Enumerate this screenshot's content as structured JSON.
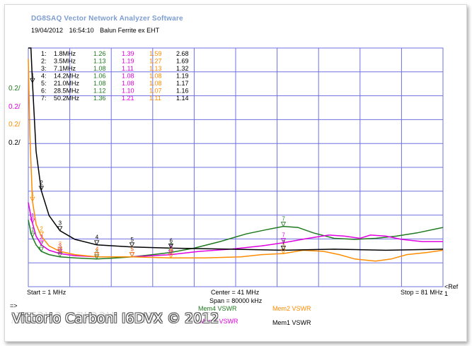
{
  "header": {
    "app_title": "DG8SAQ Vector Network Analyzer Software",
    "date": "19/04/2012",
    "time": "16:54:10",
    "device": "Balun Ferrite ex EHT"
  },
  "colors": {
    "mem1": "#000000",
    "mem2": "#ff8c00",
    "mem3": "#e000e0",
    "mem4": "#1f7a1f",
    "grid": "#7070e0"
  },
  "ylabels": [
    {
      "text": "0.2/",
      "color_key": "mem4"
    },
    {
      "text": "0.2/",
      "color_key": "mem3"
    },
    {
      "text": "0.2/",
      "color_key": "mem2"
    },
    {
      "text": "0.2/",
      "color_key": "mem1"
    }
  ],
  "markers": [
    {
      "id": "1:",
      "freq": "1.8MHz",
      "mem4": "1.26",
      "mem3": "1.39",
      "mem2": "1.59",
      "mem1": "2.68"
    },
    {
      "id": "2:",
      "freq": "3.5MHz",
      "mem4": "1.13",
      "mem3": "1.19",
      "mem2": "1.27",
      "mem1": "1.69"
    },
    {
      "id": "3:",
      "freq": "7.1MHz",
      "mem4": "1.08",
      "mem3": "1.11",
      "mem2": "1.13",
      "mem1": "1.32"
    },
    {
      "id": "4:",
      "freq": "14.2MHz",
      "mem4": "1.06",
      "mem3": "1.08",
      "mem2": "1.08",
      "mem1": "1.19"
    },
    {
      "id": "5:",
      "freq": "21.0MHz",
      "mem4": "1.08",
      "mem3": "1.08",
      "mem2": "1.08",
      "mem1": "1.17"
    },
    {
      "id": "6:",
      "freq": "28.5MHz",
      "mem4": "1.12",
      "mem3": "1.10",
      "mem2": "1.07",
      "mem1": "1.16"
    },
    {
      "id": "7:",
      "freq": "50.2MHz",
      "mem4": "1.36",
      "mem3": "1.21",
      "mem2": "1.11",
      "mem1": "1.14"
    }
  ],
  "footer": {
    "start": "Start = 1 MHz",
    "center": "Center = 41 MHz",
    "span": "Span = 80000 kHz",
    "stop": "Stop = 81 MHz",
    "ref": "<Ref",
    "ref_sub": "1",
    "arrow": "=>",
    "mem4_label": "Mem4 VSWR",
    "mem3_label": "Mem3 VSWR",
    "mem2_label": "Mem2 VSWR",
    "mem1_label": "Mem1 VSWR"
  },
  "watermark": "Vittorio Carboni I6DVX © 2012",
  "chart_data": {
    "type": "line",
    "xlabel": "",
    "ylabel": "",
    "xlim": [
      1,
      81
    ],
    "ylim": [
      1.0,
      3.0
    ],
    "y_per_div": 0.2,
    "grid": true,
    "marker_freqs": [
      1.8,
      3.5,
      7.1,
      14.2,
      21.0,
      28.5,
      50.2
    ],
    "series": [
      {
        "name": "Mem4 VSWR",
        "color_key": "mem4",
        "points": [
          [
            1,
            1.42
          ],
          [
            1.5,
            1.3
          ],
          [
            1.8,
            1.26
          ],
          [
            2.5,
            1.19
          ],
          [
            3.5,
            1.13
          ],
          [
            5,
            1.1
          ],
          [
            7.1,
            1.08
          ],
          [
            10,
            1.07
          ],
          [
            14.2,
            1.06
          ],
          [
            18,
            1.07
          ],
          [
            21,
            1.08
          ],
          [
            25,
            1.1
          ],
          [
            28.5,
            1.12
          ],
          [
            33,
            1.16
          ],
          [
            38,
            1.22
          ],
          [
            43,
            1.29
          ],
          [
            47,
            1.33
          ],
          [
            50.2,
            1.36
          ],
          [
            53,
            1.35
          ],
          [
            56,
            1.3
          ],
          [
            60,
            1.25
          ],
          [
            64,
            1.24
          ],
          [
            68,
            1.25
          ],
          [
            72,
            1.27
          ],
          [
            76,
            1.3
          ],
          [
            81,
            1.35
          ]
        ]
      },
      {
        "name": "Mem3 VSWR",
        "color_key": "mem3",
        "points": [
          [
            1,
            1.58
          ],
          [
            1.5,
            1.45
          ],
          [
            1.8,
            1.39
          ],
          [
            2.5,
            1.27
          ],
          [
            3.5,
            1.19
          ],
          [
            5,
            1.14
          ],
          [
            7.1,
            1.11
          ],
          [
            10,
            1.09
          ],
          [
            14.2,
            1.08
          ],
          [
            21,
            1.08
          ],
          [
            28.5,
            1.1
          ],
          [
            34,
            1.13
          ],
          [
            40,
            1.15
          ],
          [
            46,
            1.18
          ],
          [
            50.2,
            1.21
          ],
          [
            55,
            1.25
          ],
          [
            59,
            1.28
          ],
          [
            62,
            1.27
          ],
          [
            65,
            1.25
          ],
          [
            67,
            1.28
          ],
          [
            70,
            1.27
          ],
          [
            73,
            1.24
          ],
          [
            77,
            1.22
          ],
          [
            81,
            1.22
          ]
        ]
      },
      {
        "name": "Mem2 VSWR",
        "color_key": "mem2",
        "points": [
          [
            1,
            2.9
          ],
          [
            1.3,
            2.2
          ],
          [
            1.8,
            1.59
          ],
          [
            2.5,
            1.38
          ],
          [
            3.5,
            1.27
          ],
          [
            5,
            1.18
          ],
          [
            7.1,
            1.13
          ],
          [
            10,
            1.1
          ],
          [
            14.2,
            1.08
          ],
          [
            21,
            1.08
          ],
          [
            28.5,
            1.07
          ],
          [
            35,
            1.07
          ],
          [
            42,
            1.08
          ],
          [
            46,
            1.1
          ],
          [
            50.2,
            1.11
          ],
          [
            54,
            1.14
          ],
          [
            58,
            1.13
          ],
          [
            61,
            1.1
          ],
          [
            64,
            1.06
          ],
          [
            68,
            1.04
          ],
          [
            71,
            1.06
          ],
          [
            74,
            1.1
          ],
          [
            78,
            1.12
          ],
          [
            81,
            1.14
          ]
        ]
      },
      {
        "name": "Mem1 VSWR",
        "color_key": "mem1",
        "points": [
          [
            1,
            7.0
          ],
          [
            1.2,
            5.0
          ],
          [
            1.5,
            3.4
          ],
          [
            1.8,
            2.68
          ],
          [
            2.5,
            2.05
          ],
          [
            3.5,
            1.69
          ],
          [
            5,
            1.46
          ],
          [
            7.1,
            1.32
          ],
          [
            10,
            1.24
          ],
          [
            14.2,
            1.19
          ],
          [
            21,
            1.17
          ],
          [
            28.5,
            1.16
          ],
          [
            40,
            1.15
          ],
          [
            50.2,
            1.14
          ],
          [
            60,
            1.15
          ],
          [
            70,
            1.14
          ],
          [
            81,
            1.15
          ]
        ]
      }
    ]
  }
}
